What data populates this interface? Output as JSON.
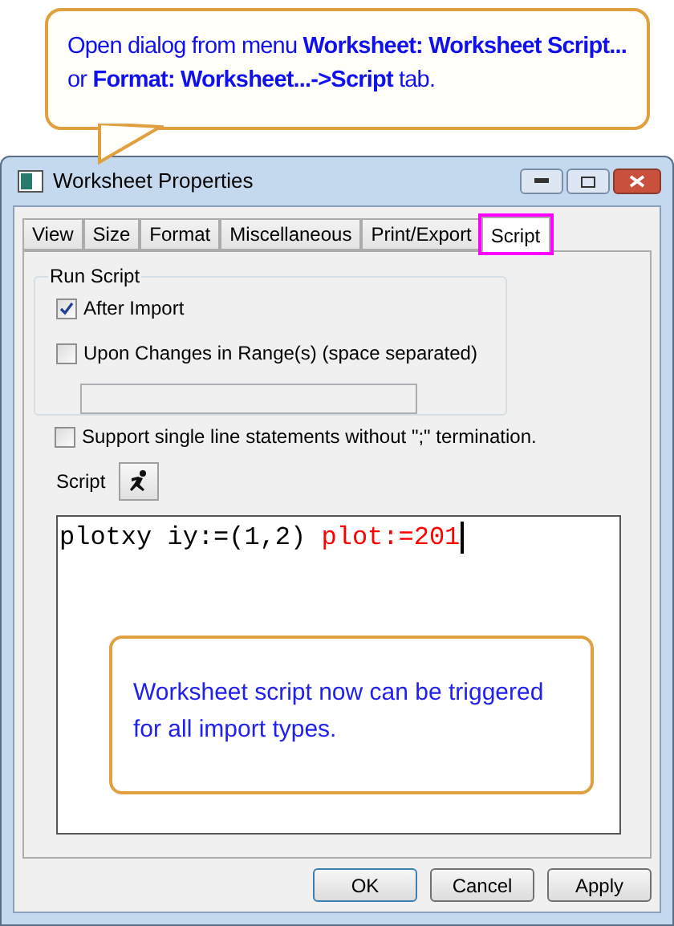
{
  "callout": {
    "text": "Open dialog from menu **Worksheet: Worksheet Script...** or **Format: Worksheet...->Script** tab."
  },
  "window": {
    "title": "Worksheet Properties"
  },
  "tabs": [
    {
      "label": "View",
      "selected": false,
      "highlighted": false
    },
    {
      "label": "Size",
      "selected": false,
      "highlighted": false
    },
    {
      "label": "Format",
      "selected": false,
      "highlighted": false
    },
    {
      "label": "Miscellaneous",
      "selected": false,
      "highlighted": false
    },
    {
      "label": "Print/Export",
      "selected": false,
      "highlighted": false
    },
    {
      "label": "Script",
      "selected": true,
      "highlighted": true
    }
  ],
  "run_script": {
    "title": "Run Script",
    "options": [
      {
        "label": "After Import",
        "checked": true
      },
      {
        "label": "Upon Changes in Range(s) (space separated)",
        "checked": false
      }
    ]
  },
  "support_single_line": {
    "label": "Support single line statements without  \";\" termination.",
    "checked": false
  },
  "script": {
    "label": "Script",
    "code": [
      {
        "text": "plotxy iy:=(1,2) ",
        "color": "#000000"
      },
      {
        "text": "plot:=201",
        "color": "#ff0000"
      }
    ]
  },
  "annotation": {
    "text": "Worksheet script now can be triggered for all import types."
  },
  "buttons": [
    {
      "label": "OK",
      "default": true
    },
    {
      "label": "Cancel",
      "default": false
    },
    {
      "label": "Apply",
      "default": false
    }
  ]
}
